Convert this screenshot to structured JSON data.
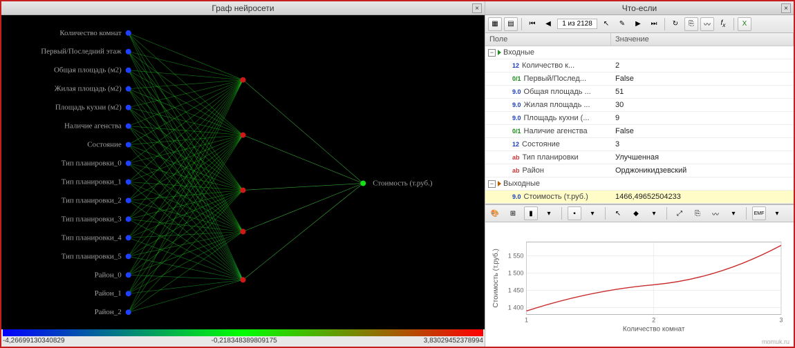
{
  "left": {
    "title": "Граф нейросети",
    "inputs": [
      "Количество комнат",
      "Первый/Последний этаж",
      "Общая площадь (м2)",
      "Жилая площадь (м2)",
      "Площадь кухни (м2)",
      "Наличие агенства",
      "Состояние",
      "Тип планировки_0",
      "Тип планировки_1",
      "Тип планировки_2",
      "Тип планировки_3",
      "Тип планировки_4",
      "Тип планировки_5",
      "Район_0",
      "Район_1",
      "Район_2"
    ],
    "output": "Стоимость (т.руб.)",
    "scale": {
      "min": "-4,26699130340829",
      "mid": "-0,218348389809175",
      "max": "3,83029452378994"
    }
  },
  "right": {
    "title": "Что-если",
    "nav": "1 из 2128",
    "columns": {
      "field": "Поле",
      "value": "Значение"
    },
    "groups": {
      "inputs_label": "Входные",
      "outputs_label": "Выходные"
    },
    "rows": [
      {
        "type": "12",
        "label": "Количество к...",
        "value": "2"
      },
      {
        "type": "0/1",
        "label": "Первый/Послед...",
        "value": "False"
      },
      {
        "type": "9.0",
        "label": "Общая площадь ...",
        "value": "51"
      },
      {
        "type": "9.0",
        "label": "Жилая площадь ...",
        "value": "30"
      },
      {
        "type": "9.0",
        "label": "Площадь кухни (...",
        "value": "9"
      },
      {
        "type": "0/1",
        "label": "Наличие агенства",
        "value": "False"
      },
      {
        "type": "12",
        "label": "Состояние",
        "value": "3"
      },
      {
        "type": "ab",
        "label": "Тип планировки",
        "value": "Улучшенная"
      },
      {
        "type": "ab",
        "label": "Район",
        "value": "Орджоникидзевский"
      }
    ],
    "output_row": {
      "type": "9.0",
      "label": "Стоимость (т.руб.)",
      "value": "1466,49652504233"
    }
  },
  "chart_data": {
    "type": "line",
    "title": "",
    "xlabel": "Количество комнат",
    "ylabel": "Стоимость (т.руб.)",
    "x": [
      1,
      2,
      3
    ],
    "y": [
      1390,
      1466,
      1580
    ],
    "xlim": [
      1,
      3
    ],
    "ylim": [
      1380,
      1590
    ],
    "yticks": [
      1400,
      1450,
      1500,
      1550
    ],
    "xticks": [
      1,
      2,
      3
    ]
  },
  "watermark": "momuk.ru"
}
